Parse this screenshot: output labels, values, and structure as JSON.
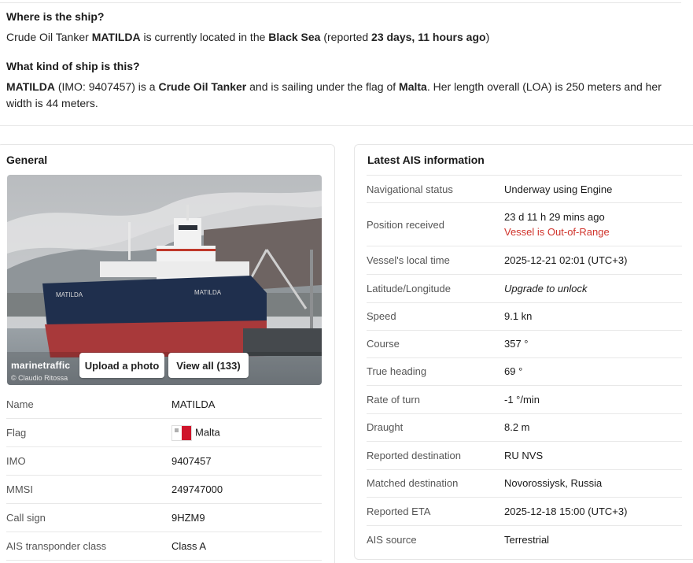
{
  "where": {
    "title": "Where is the ship?",
    "prefix": "Crude Oil Tanker ",
    "name": "MATILDA",
    "mid": " is currently located in the ",
    "sea": "Black Sea",
    "reported_prefix": " (reported ",
    "reported": "23 days, 11 hours ago",
    "reported_suffix": ")"
  },
  "kind": {
    "title": "What kind of ship is this?",
    "name": "MATILDA",
    "imo_text": " (IMO: 9407457) is a ",
    "type": "Crude Oil Tanker",
    "flag_text": " and is sailing under the flag of ",
    "flag": "Malta",
    "rest_line1": ". Her length overall (LOA) is 250 meters and her",
    "rest_line2": "width is 44 meters."
  },
  "general": {
    "title": "General",
    "upload_label": "Upload a photo",
    "view_all_label": "View all (133)",
    "watermark": "marinetraffic",
    "credit": "© Claudio Ritossa",
    "rows": [
      {
        "label": "Name",
        "value": "MATILDA"
      },
      {
        "label": "Flag",
        "value": "Malta"
      },
      {
        "label": "IMO",
        "value": "9407457"
      },
      {
        "label": "MMSI",
        "value": "249747000"
      },
      {
        "label": "Call sign",
        "value": "9HZM9"
      },
      {
        "label": "AIS transponder class",
        "value": "Class A"
      }
    ]
  },
  "ais": {
    "title": "Latest AIS information",
    "rows": [
      {
        "label": "Navigational status",
        "value": "Underway using Engine"
      },
      {
        "label": "Position received",
        "value": "23 d 11 h 29 mins ago",
        "note": "Vessel is Out-of-Range"
      },
      {
        "label": "Vessel's local time",
        "value": "2025-12-21 02:01 (UTC+3)"
      },
      {
        "label": "Latitude/Longitude",
        "value": "Upgrade to unlock"
      },
      {
        "label": "Speed",
        "value": "9.1 kn"
      },
      {
        "label": "Course",
        "value": "357 °"
      },
      {
        "label": "True heading",
        "value": "69 °"
      },
      {
        "label": "Rate of turn",
        "value": "-1 °/min"
      },
      {
        "label": "Draught",
        "value": "8.2 m"
      },
      {
        "label": "Reported destination",
        "value": "RU NVS"
      },
      {
        "label": "Matched destination",
        "value": "Novorossiysk, Russia"
      },
      {
        "label": "Reported ETA",
        "value": "2025-12-18 15:00 (UTC+3)"
      },
      {
        "label": "AIS source",
        "value": "Terrestrial"
      }
    ]
  },
  "colors": {
    "warning": "#d0342c",
    "hull_red": "#a8393a",
    "hull_navy": "#1f2f4d"
  }
}
